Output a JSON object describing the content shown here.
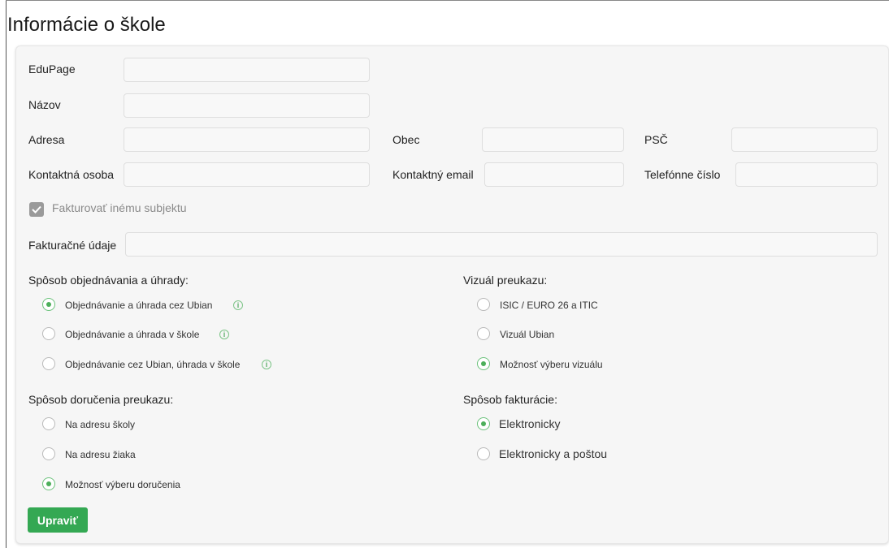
{
  "page": {
    "title": "Informácie o škole"
  },
  "form": {
    "edupage": {
      "label": "EduPage",
      "value": ""
    },
    "nazov": {
      "label": "Názov",
      "value": ""
    },
    "adresa": {
      "label": "Adresa",
      "value": ""
    },
    "obec": {
      "label": "Obec",
      "value": ""
    },
    "psc": {
      "label": "PSČ",
      "value": ""
    },
    "kontaktna_osoba": {
      "label": "Kontaktná osoba",
      "value": ""
    },
    "kontaktny_email": {
      "label": "Kontaktný email",
      "value": ""
    },
    "telefon": {
      "label": "Telefónne číslo",
      "value": ""
    },
    "fakturovat": {
      "label": "Fakturovať inému subjektu",
      "checked": true
    },
    "fakturacne_udaje": {
      "label": "Fakturačné údaje",
      "value": ""
    }
  },
  "objednavanie": {
    "title": "Spôsob objednávania a úhrady:",
    "options": [
      {
        "label": "Objednávanie a úhrada cez Ubian",
        "selected": true,
        "info": "i"
      },
      {
        "label": "Objednávanie a úhrada v škole",
        "selected": false,
        "info": "i"
      },
      {
        "label": "Objednávanie cez Ubian, úhrada v škole",
        "selected": false,
        "info": "i"
      }
    ]
  },
  "vizual": {
    "title": "Vizuál preukazu:",
    "options": [
      {
        "label": "ISIC / EURO 26 a ITIC",
        "selected": false
      },
      {
        "label": "Vizuál Ubian",
        "selected": false
      },
      {
        "label": "Možnosť výberu vizuálu",
        "selected": true
      }
    ]
  },
  "dorucenie": {
    "title": "Spôsob doručenia preukazu:",
    "options": [
      {
        "label": "Na adresu školy",
        "selected": false
      },
      {
        "label": "Na adresu žiaka",
        "selected": false
      },
      {
        "label": "Možnosť výberu doručenia",
        "selected": true
      }
    ]
  },
  "fakturacia": {
    "title": "Spôsob fakturácie:",
    "options": [
      {
        "label": "Elektronicky",
        "selected": true
      },
      {
        "label": "Elektronicky a poštou",
        "selected": false
      }
    ]
  },
  "actions": {
    "edit_label": "Upraviť"
  },
  "colors": {
    "accent": "#34a853",
    "radio_selected": "#4caf5a",
    "panel_bg": "#f6f6f6"
  },
  "icons": {
    "info": "info-circle-icon",
    "check": "checkmark-icon"
  }
}
